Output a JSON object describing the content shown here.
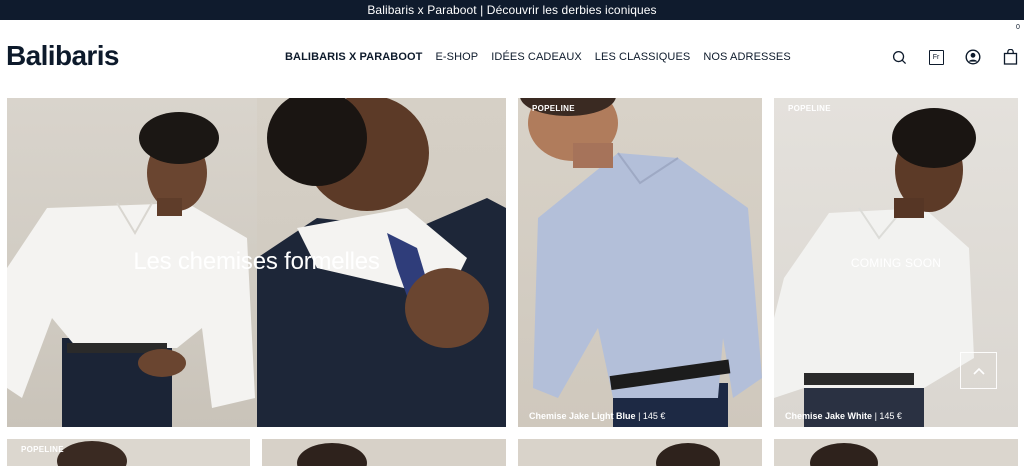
{
  "announcement": "Balibaris x Paraboot | Découvrir les derbies iconiques",
  "brand": {
    "logo": "Balibaris"
  },
  "nav": [
    {
      "label": "BALIBARIS X PARABOOT",
      "bold": true
    },
    {
      "label": "E-SHOP"
    },
    {
      "label": "IDÉES CADEAUX"
    },
    {
      "label": "LES CLASSIQUES"
    },
    {
      "label": "NOS ADRESSES"
    }
  ],
  "header_icons": {
    "search": "search-icon",
    "language": "Fr",
    "account": "user-icon",
    "cart": "bag-icon",
    "cart_count": "0"
  },
  "hero": {
    "title": "Les chemises formelles"
  },
  "products": [
    {
      "tag": "POPELINE",
      "name": "Chemise Jake Light Blue",
      "price": "145 €",
      "status": ""
    },
    {
      "tag": "POPELINE",
      "name": "Chemise Jake White",
      "price": "145 €",
      "status": "COMING SOON"
    }
  ],
  "bottom_row": [
    {
      "tag": "POPELINE"
    }
  ],
  "colors": {
    "navy": "#0f1b2d",
    "text": "#0d1a2b",
    "white": "#ffffff"
  }
}
